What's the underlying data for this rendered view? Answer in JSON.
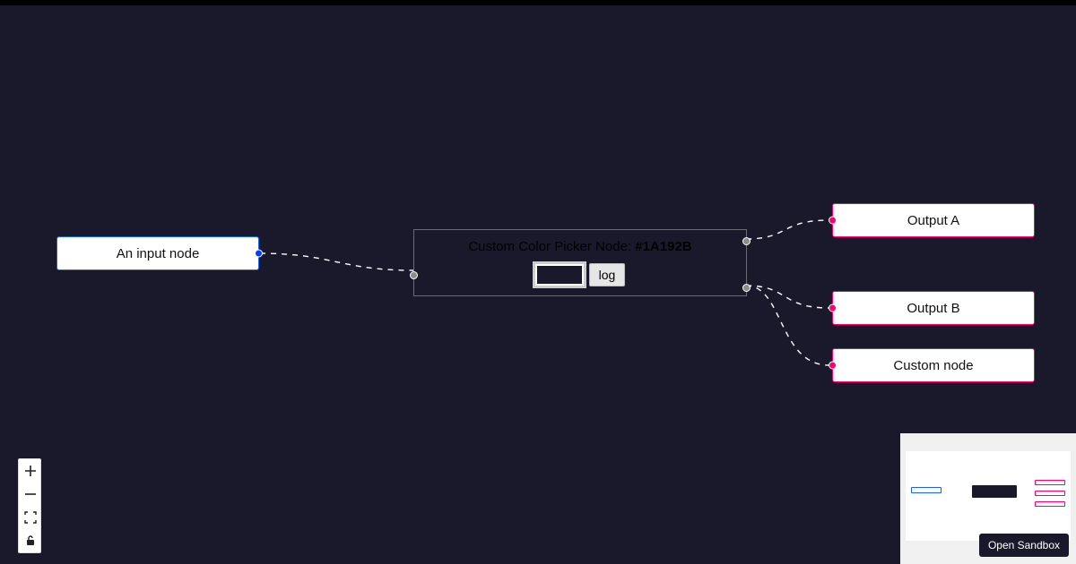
{
  "colors": {
    "canvas_bg": "#1A192B",
    "input_border": "#1a65e6",
    "output_border": "#ff0072"
  },
  "nodes": {
    "input": {
      "label": "An input node"
    },
    "center": {
      "title_prefix": "Custom Color Picker Node: ",
      "hex": "#1A192B",
      "log_button": "log"
    },
    "outputs": [
      {
        "label": "Output A"
      },
      {
        "label": "Output B"
      },
      {
        "label": "Custom node"
      }
    ]
  },
  "controls": {
    "zoom_in": "+",
    "zoom_out": "−",
    "fit": "⛶",
    "lock": "🔓"
  },
  "sandbox_button": "Open Sandbox"
}
